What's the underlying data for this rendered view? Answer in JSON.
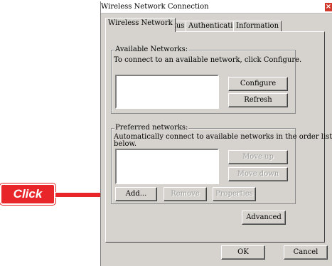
{
  "window": {
    "title": "Wireless Network Connection",
    "close_glyph": "×"
  },
  "tabs": [
    "Wireless Network",
    "Status",
    "Authentication",
    "Information"
  ],
  "available": {
    "legend": "Available Networks:",
    "description": "To connect to an available network, click Configure.",
    "configure_label": "Configure",
    "refresh_label": "Refresh"
  },
  "preferred": {
    "legend": "Preferred networks:",
    "description_line1": "Automatically connect to available networks in the order listed",
    "description_line2": "below.",
    "move_up_label": "Move up",
    "move_down_label": "Move down",
    "add_label": "Add...",
    "remove_label": "Remove",
    "properties_label": "Properties"
  },
  "advanced_label": "Advanced",
  "footer": {
    "ok_label": "OK",
    "cancel_label": "Cancel"
  },
  "callout": {
    "label": "Click",
    "color": "#e8262a"
  }
}
